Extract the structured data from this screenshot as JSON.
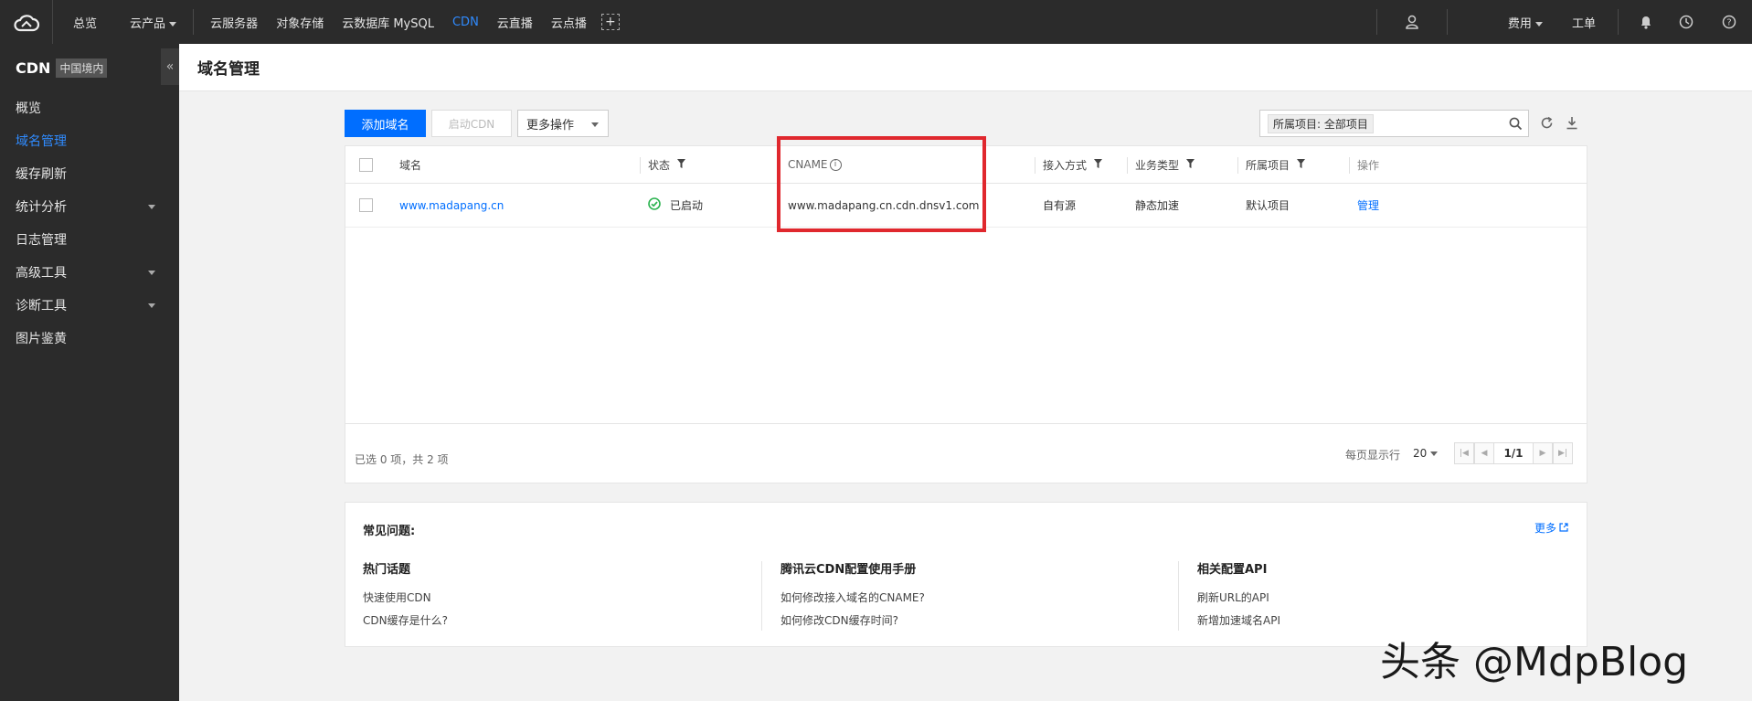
{
  "topbar": {
    "logo": "cloud-logo-icon",
    "nav": [
      {
        "label": "总览"
      },
      {
        "label": "云产品"
      }
    ],
    "products": [
      {
        "label": "云服务器"
      },
      {
        "label": "对象存储"
      },
      {
        "label": "云数据库 MySQL"
      },
      {
        "label": "CDN"
      },
      {
        "label": "云直播"
      },
      {
        "label": "云点播"
      }
    ],
    "plus": "+",
    "right": {
      "billing": "费用",
      "ticket": "工单"
    }
  },
  "sidebar": {
    "title": "CDN",
    "region": "中国境内",
    "collapse": "«",
    "items": [
      {
        "label": "概览"
      },
      {
        "label": "域名管理"
      },
      {
        "label": "缓存刷新"
      },
      {
        "label": "统计分析"
      },
      {
        "label": "日志管理"
      },
      {
        "label": "高级工具"
      },
      {
        "label": "诊断工具"
      },
      {
        "label": "图片鉴黄"
      }
    ]
  },
  "page": {
    "title": "域名管理"
  },
  "toolbar": {
    "add_domain": "添加域名",
    "start_cdn": "启动CDN",
    "more_actions": "更多操作",
    "project_tag": "所属项目: 全部项目"
  },
  "table": {
    "headers": {
      "domain": "域名",
      "status": "状态",
      "cname": "CNAME",
      "access": "接入方式",
      "business": "业务类型",
      "project": "所属项目",
      "action": "操作"
    },
    "rows": [
      {
        "domain": "www.madapang.cn",
        "status": "已启动",
        "cname": "www.madapang.cn.cdn.dnsv1.com",
        "access": "自有源",
        "business": "静态加速",
        "project": "默认项目",
        "action": "管理"
      }
    ],
    "footer": {
      "selection": "已选 0 项，共 2 项",
      "per_page_label": "每页显示行",
      "per_page": "20",
      "page": "1/1"
    }
  },
  "faq": {
    "title": "常见问题:",
    "more": "更多",
    "columns": [
      {
        "title": "热门话题",
        "links": [
          "快速使用CDN",
          "CDN缓存是什么?"
        ]
      },
      {
        "title": "腾讯云CDN配置使用手册",
        "links": [
          "如何修改接入域名的CNAME?",
          "如何修改CDN缓存时间?"
        ]
      },
      {
        "title": "相关配置API",
        "links": [
          "刷新URL的API",
          "新增加速域名API"
        ]
      }
    ]
  },
  "watermark": "头条 @MdpBlog",
  "colors": {
    "accent": "#006eff",
    "topbar": "#2b2b2b",
    "highlight": "#e0282e",
    "success": "#2bb34f"
  }
}
